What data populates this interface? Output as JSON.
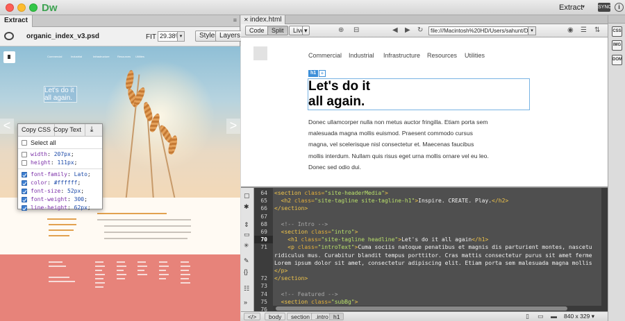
{
  "app": {
    "logo": "Dw",
    "workspace": "Extract",
    "workspace_caret": "▾",
    "sync": "SYNC",
    "help": "i"
  },
  "extract_panel": {
    "tab": "Extract",
    "file_name": "organic_index_v3.psd",
    "fit_label": "FIT",
    "zoom": "29.38%",
    "styles_btn": "Styles",
    "layers_btn": "Layers",
    "hero_text": "Let's do it all again."
  },
  "copy_popup": {
    "copy_css": "Copy CSS",
    "copy_text": "Copy Text",
    "download_icon": "download-icon",
    "select_all": "Select all",
    "properties": [
      {
        "name": "width",
        "value": "207px",
        "checked": false
      },
      {
        "name": "height",
        "value": "111px",
        "checked": false
      },
      {
        "name": "font-family",
        "value": "Lato",
        "checked": true
      },
      {
        "name": "color",
        "value": "#ffffff",
        "checked": true
      },
      {
        "name": "font-size",
        "value": "52px",
        "checked": true
      },
      {
        "name": "font-weight",
        "value": "300",
        "checked": true
      },
      {
        "name": "line-height",
        "value": "62px",
        "checked": true
      }
    ]
  },
  "document": {
    "tab": "index.html",
    "code_btn": "Code",
    "split_btn": "Split",
    "live_btn": "Live",
    "url": "file:///Macintosh%20HD/Users/sahunt/Des...",
    "nav": [
      "Commercial",
      "Industrial",
      "Infrastructure",
      "Resources",
      "Utilities"
    ],
    "h1_tag": "h1",
    "h1_plus": "+",
    "h1_line1": "Let's do it",
    "h1_line2": "all again.",
    "intro": "Donec ullamcorper nulla non metus auctor fringilla. Etiam porta sem malesuada magna mollis euismod. Praesent commodo cursus magna, vel scelerisque nisl consectetur et. Maecenas faucibus mollis interdum. Nullam quis risus eget urna mollis ornare vel eu leo. Donec sed odio dui."
  },
  "code": {
    "lines": [
      {
        "n": "64",
        "html": "<span class=\"tg\">&lt;section</span> <span class=\"at\">class=</span><span class=\"st\">\"site-headerMedia\"</span><span class=\"tg\">&gt;</span>"
      },
      {
        "n": "65",
        "html": "  <span class=\"tg\">&lt;h2</span> <span class=\"at\">class=</span><span class=\"st\">\"site-tagline site-tagline-h1\"</span><span class=\"tg\">&gt;</span><span class=\"tx\">Inspire. CREATE. Play.</span><span class=\"tg\">&lt;/h2&gt;</span>"
      },
      {
        "n": "66",
        "html": "<span class=\"tg\">&lt;/section&gt;</span>"
      },
      {
        "n": "67",
        "html": ""
      },
      {
        "n": "68",
        "html": "  <span class=\"cm\">&lt;!-- Intro --&gt;</span>"
      },
      {
        "n": "69",
        "html": "  <span class=\"tg\">&lt;section</span> <span class=\"at\">class=</span><span class=\"st\">\"intro\"</span><span class=\"tg\">&gt;</span>"
      },
      {
        "n": "70",
        "html": "    <span class=\"tg\">&lt;h1</span> <span class=\"at\">class=</span><span class=\"st\">\"site-tagline headline\"</span><span class=\"tg\">&gt;</span><span class=\"tx\">Let's do it all again</span><span class=\"tg\">&lt;/h1&gt;</span>",
        "current": true
      },
      {
        "n": "71",
        "html": "    <span class=\"tg\">&lt;p</span> <span class=\"at\">class=</span><span class=\"st\">\"introText\"</span><span class=\"tg\">&gt;</span><span class=\"tx\">Cuma sociis natoque penatibus et magnis dis parturient montes, nascetu</span>"
      },
      {
        "n": "",
        "html": "<span class=\"tx\">ridiculus mus. Curabitur blandit tempus porttitor. Cras mattis consectetur purus sit amet ferme</span>"
      },
      {
        "n": "",
        "html": "<span class=\"tx\">Lorem ipsum dolor sit amet, consectetur adipiscing elit. Etiam porta sem malesuada magna mollis</span>"
      },
      {
        "n": "",
        "html": "<span class=\"tg\">&lt;/p&gt;</span>"
      },
      {
        "n": "72",
        "html": "<span class=\"tg\">&lt;/section&gt;</span>"
      },
      {
        "n": "73",
        "html": ""
      },
      {
        "n": "74",
        "html": "  <span class=\"cm\">&lt;!-- Featured --&gt;</span>"
      },
      {
        "n": "75",
        "html": "  <span class=\"tg\">&lt;section</span> <span class=\"at\">class=</span><span class=\"st\">\"subBg\"</span><span class=\"tg\">&gt;</span>"
      },
      {
        "n": "76",
        "html": "    <span class=\"tg\">&lt;/section&gt;</span>"
      }
    ]
  },
  "status": {
    "tag_toggle": "</>",
    "crumbs": [
      "body",
      "section",
      ".intro",
      "h1"
    ],
    "dimensions": "840 x 329 ▾"
  },
  "right_strip": [
    "CSS",
    "IMG",
    "DOM"
  ]
}
